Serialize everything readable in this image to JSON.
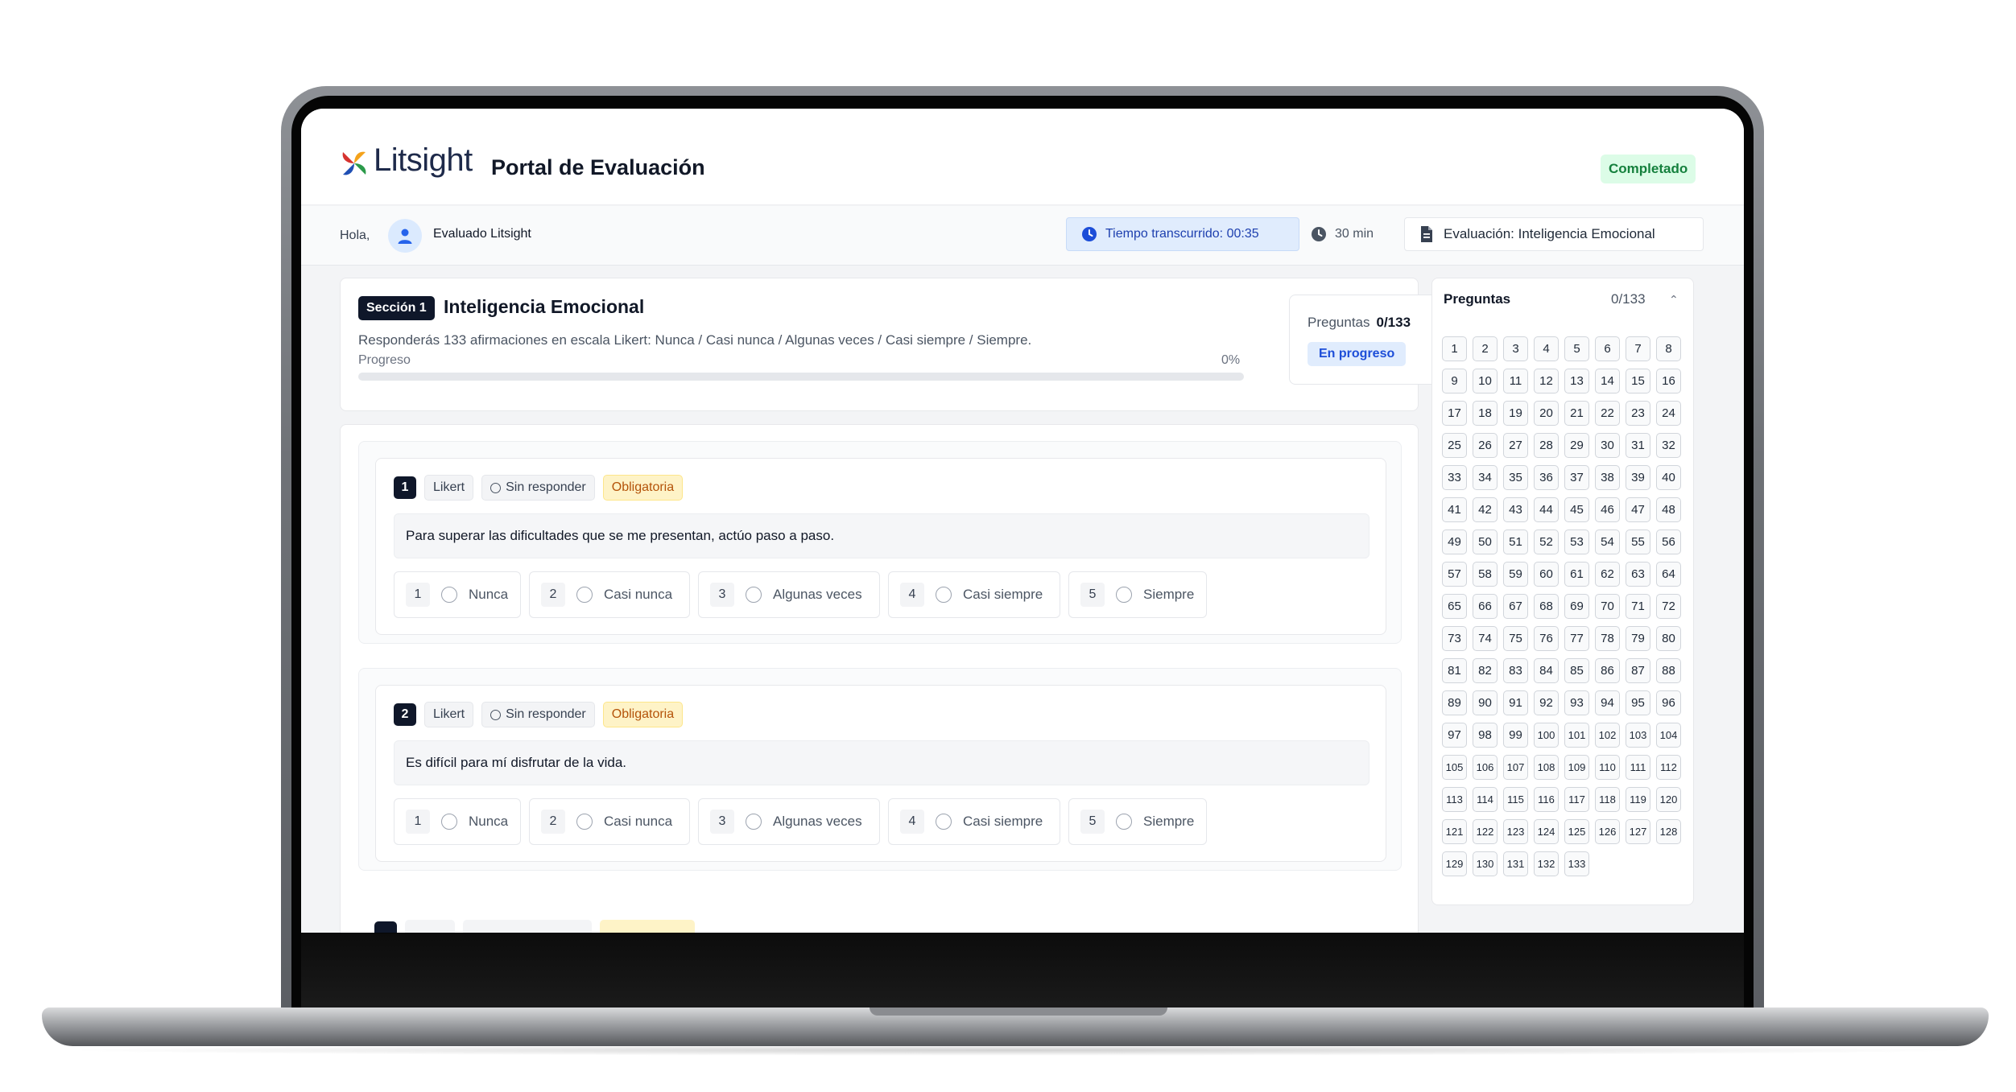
{
  "header": {
    "brand": "Litsight",
    "portal_title": "Portal de Evaluación",
    "status_badge": "Completado"
  },
  "subheader": {
    "greeting": "Hola,",
    "user_name": "Evaluado Litsight",
    "timer": "Tiempo transcurrido: 00:35",
    "duration": "30 min",
    "evaluation": "Evaluación: Inteligencia Emocional"
  },
  "section": {
    "badge": "Sección 1",
    "title": "Inteligencia Emocional",
    "description": "Responderás 133 afirmaciones en escala Likert: Nunca / Casi nunca / Algunas veces / Casi siempre / Siempre.",
    "progress_label": "Progreso",
    "progress_percent_text": "0%",
    "progress_fraction": 0,
    "questions_label": "Preguntas",
    "questions_count": "0/133",
    "status": "En progreso"
  },
  "questions": [
    {
      "number": "1",
      "type": "Likert",
      "state": "Sin responder",
      "required": "Obligatoria",
      "text": "Para superar las dificultades que se me presentan, actúo paso a paso.",
      "options": [
        {
          "n": "1",
          "label": "Nunca"
        },
        {
          "n": "2",
          "label": "Casi nunca"
        },
        {
          "n": "3",
          "label": "Algunas veces"
        },
        {
          "n": "4",
          "label": "Casi siempre"
        },
        {
          "n": "5",
          "label": "Siempre"
        }
      ]
    },
    {
      "number": "2",
      "type": "Likert",
      "state": "Sin responder",
      "required": "Obligatoria",
      "text": "Es difícil para mí disfrutar de la vida.",
      "options": [
        {
          "n": "1",
          "label": "Nunca"
        },
        {
          "n": "2",
          "label": "Casi nunca"
        },
        {
          "n": "3",
          "label": "Algunas veces"
        },
        {
          "n": "4",
          "label": "Casi siempre"
        },
        {
          "n": "5",
          "label": "Siempre"
        }
      ]
    }
  ],
  "sidebar": {
    "title": "Preguntas",
    "count": "0/133",
    "total_questions": 133
  },
  "colors": {
    "accent": "#2563eb",
    "navy": "#0f172a",
    "success_bg": "#dcfce7",
    "success_text": "#15803d",
    "warning_bg": "#fef3c7",
    "warning_text": "#b45309"
  },
  "icons": {
    "timer": "clock-icon",
    "duration": "clock-icon",
    "evaluation": "document-icon",
    "avatar": "user-icon",
    "collapse": "chevron-up-icon"
  }
}
